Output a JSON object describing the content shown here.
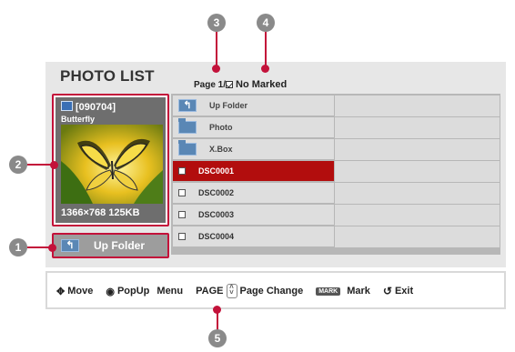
{
  "title": "PHOTO LIST",
  "page": "Page 1/1",
  "marked": "No Marked",
  "thumbnail": {
    "id": "[090704]",
    "name": "Butterfly",
    "info": "1366×768  125KB"
  },
  "up_button_label": "Up Folder",
  "list": [
    {
      "label": "Up Folder",
      "icon": "up-arrow-icon"
    },
    {
      "label": "Photo",
      "icon": "folder-icon"
    },
    {
      "label": "X.Box",
      "icon": "folder-icon"
    },
    {
      "label": "DSC0001",
      "icon": "checkbox",
      "selected": true
    },
    {
      "label": "DSC0002",
      "icon": "checkbox"
    },
    {
      "label": "DSC0003",
      "icon": "checkbox"
    },
    {
      "label": "DSC0004",
      "icon": "checkbox"
    }
  ],
  "bottom": {
    "move": "Move",
    "popup": "PopUp",
    "menu": "Menu",
    "page": "PAGE",
    "page_change": "Page  Change",
    "mark_badge": "MARK",
    "mark": "Mark",
    "exit": "Exit"
  },
  "callouts": [
    "1",
    "2",
    "3",
    "4",
    "5"
  ],
  "colors": {
    "accent": "#c3123a",
    "selected_row": "#b20d0d",
    "panel": "#e7e7e7"
  }
}
